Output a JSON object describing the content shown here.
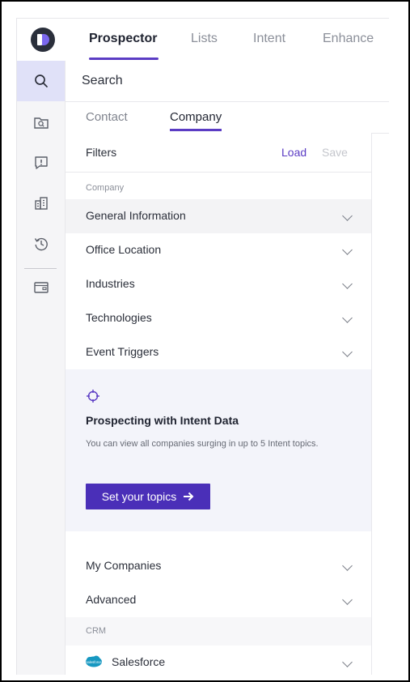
{
  "nav": {
    "tabs": [
      {
        "label": "Prospector"
      },
      {
        "label": "Lists"
      },
      {
        "label": "Intent"
      },
      {
        "label": "Enhance"
      }
    ]
  },
  "rail": {
    "icons": [
      "search-icon",
      "folder-search-icon",
      "alert-message-icon",
      "buildings-icon",
      "history-icon",
      "wallet-icon"
    ]
  },
  "search": {
    "label": "Search"
  },
  "subtabs": [
    {
      "label": "Contact"
    },
    {
      "label": "Company"
    }
  ],
  "filters": {
    "title": "Filters",
    "load_label": "Load",
    "save_label": "Save"
  },
  "sections": {
    "company_label": "Company",
    "crm_label": "CRM"
  },
  "company_rows": [
    {
      "label": "General Information"
    },
    {
      "label": "Office Location"
    },
    {
      "label": "Industries"
    },
    {
      "label": "Technologies"
    },
    {
      "label": "Event Triggers"
    }
  ],
  "intent_card": {
    "title": "Prospecting with Intent Data",
    "text": "You can view all companies surging in up to 5 Intent topics.",
    "button_label": "Set your topics"
  },
  "more_rows": [
    {
      "label": "My Companies"
    },
    {
      "label": "Advanced"
    }
  ],
  "crm_rows": [
    {
      "label": "Salesforce",
      "logo_text": "salesforce"
    }
  ],
  "colors": {
    "accent": "#5b3cc4",
    "button": "#4a2fb8",
    "salesforce": "#1798c1"
  }
}
